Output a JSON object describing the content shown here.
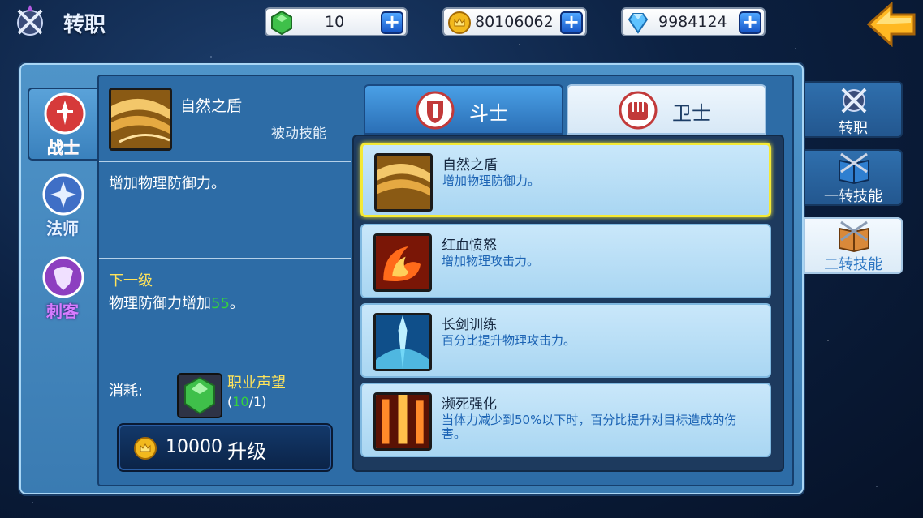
{
  "header": {
    "title": "转职",
    "resources": [
      {
        "name": "gem",
        "icon": "green-gem-icon",
        "value": "10"
      },
      {
        "name": "gold",
        "icon": "gold-coin-icon",
        "value": "80106062"
      },
      {
        "name": "diamond",
        "icon": "blue-diamond-icon",
        "value": "9984124"
      }
    ]
  },
  "classes": [
    {
      "label": "战士",
      "icon": "warrior-emblem-icon",
      "active": true
    },
    {
      "label": "法师",
      "icon": "mage-emblem-icon",
      "active": false
    },
    {
      "label": "刺客",
      "icon": "assassin-emblem-icon",
      "active": false
    }
  ],
  "detail": {
    "name": "自然之盾",
    "type": "被动技能",
    "description": "增加物理防御力。",
    "next_level_title": "下一级",
    "next_level_text": "物理防御力增加",
    "next_level_value": "55",
    "next_level_suffix": "。",
    "cost_label": "消耗:",
    "cost_item_name": "职业声望",
    "cost_have": "10",
    "cost_need": "/1)",
    "cost_open": "(",
    "upgrade_cost": "10000",
    "upgrade_label": "升级"
  },
  "subtabs": [
    {
      "label": "斗士",
      "icon": "fighter-shield-icon",
      "active": true
    },
    {
      "label": "卫士",
      "icon": "guardian-fist-icon",
      "active": false
    }
  ],
  "skills": [
    {
      "name": "自然之盾",
      "desc": "增加物理防御力。",
      "icon": "nature-shield-icon",
      "selected": true
    },
    {
      "name": "红血愤怒",
      "desc": "增加物理攻击力。",
      "icon": "blood-rage-icon",
      "selected": false
    },
    {
      "name": "长剑训练",
      "desc": "百分比提升物理攻击力。",
      "icon": "sword-training-icon",
      "selected": false
    },
    {
      "name": "濒死强化",
      "desc": "当体力减少到50%以下时，百分比提升对目标造成的伤害。",
      "icon": "near-death-boost-icon",
      "selected": false
    }
  ],
  "right_tabs": [
    {
      "label": "转职",
      "icon": "crossed-swords-icon",
      "style": "dark"
    },
    {
      "label": "一转技能",
      "icon": "skill-book-icon",
      "style": "dark"
    },
    {
      "label": "二转技能",
      "icon": "skill-book-open-icon",
      "style": "light"
    }
  ],
  "colors": {
    "accent_yellow": "#f4e935",
    "green_value": "#34d23c",
    "panel_blue": "#3a7bb2"
  }
}
